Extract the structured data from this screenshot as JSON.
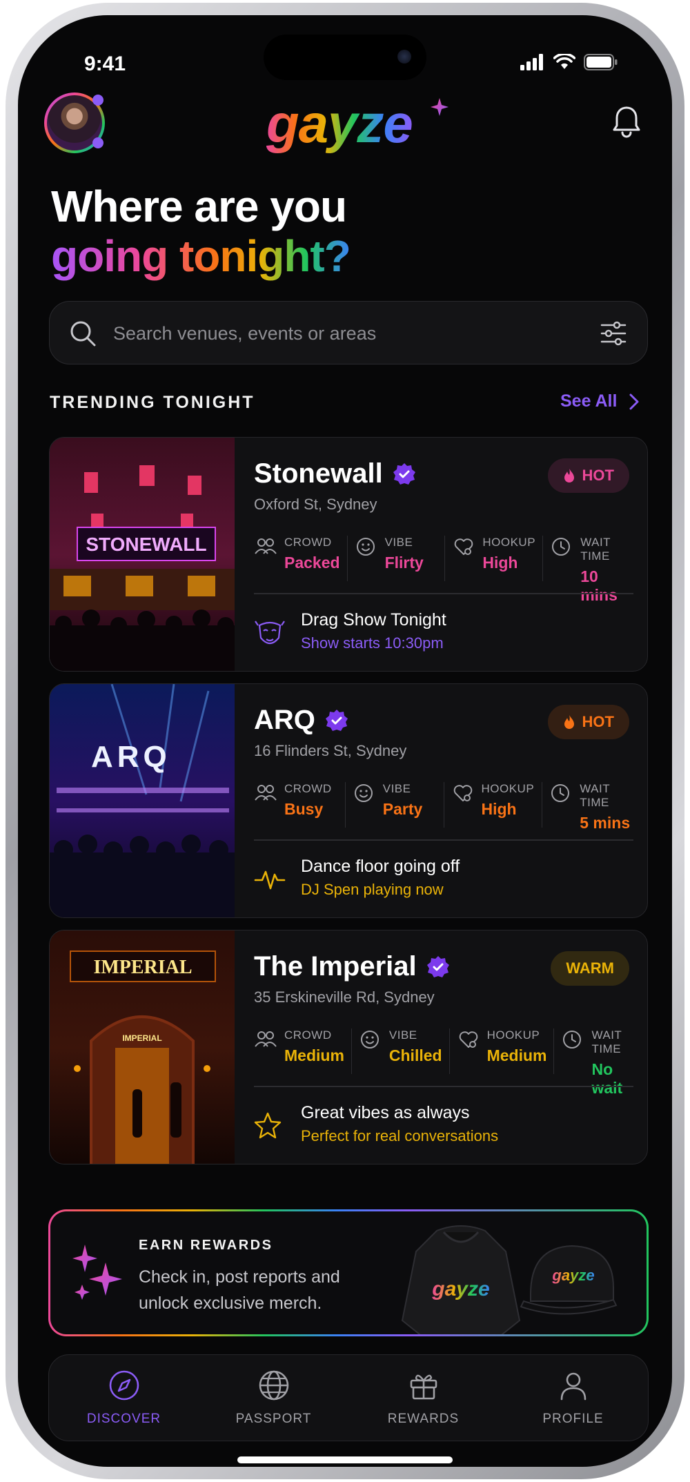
{
  "status": {
    "time": "9:41"
  },
  "header": {
    "logo": "gayze"
  },
  "hero": {
    "line1": "Where are you",
    "line2": "going tonight?"
  },
  "search": {
    "placeholder": "Search venues, events or areas"
  },
  "trending": {
    "title": "TRENDING TONIGHT",
    "see_all": "See All"
  },
  "labels": {
    "crowd": "CROWD",
    "vibe": "VIBE",
    "hookup": "HOOKUP",
    "wait": "WAIT TIME"
  },
  "venues": [
    {
      "name": "Stonewall",
      "address": "Oxford St, Sydney",
      "sign": "STONEWALL",
      "badge": "HOT",
      "badge_color": "#ec4899",
      "crowd": "Packed",
      "vibe": "Flirty",
      "hookup": "High",
      "wait": "10 mins",
      "value_color": "#ec4899",
      "note_title": "Drag Show Tonight",
      "note_sub": "Show starts 10:30pm",
      "note_color": "#8b5cf6",
      "note_icon": "drag-mask-icon"
    },
    {
      "name": "ARQ",
      "address": "16 Flinders St, Sydney",
      "sign": "ARQ",
      "badge": "HOT",
      "badge_color": "#f97316",
      "crowd": "Busy",
      "vibe": "Party",
      "hookup": "High",
      "wait": "5 mins",
      "value_color": "#f97316",
      "note_title": "Dance floor going off",
      "note_sub": "DJ Spen playing now",
      "note_color": "#eab308",
      "note_icon": "pulse-icon"
    },
    {
      "name": "The Imperial",
      "address": "35 Erskineville Rd, Sydney",
      "sign": "IMPERIAL",
      "badge": "WARM",
      "badge_color": "#eab308",
      "crowd": "Medium",
      "vibe": "Chilled",
      "hookup": "Medium",
      "wait": "No wait",
      "value_color": "#eab308",
      "wait_color": "#22c55e",
      "note_title": "Great vibes as always",
      "note_sub": "Perfect for real conversations",
      "note_color": "#eab308",
      "note_icon": "star-icon"
    }
  ],
  "rewards": {
    "title": "EARN REWARDS",
    "text": "Check in, post reports and unlock exclusive merch.",
    "merch_logo": "gayze"
  },
  "tabs": [
    {
      "label": "DISCOVER",
      "icon": "compass-icon",
      "active": true
    },
    {
      "label": "PASSPORT",
      "icon": "globe-icon",
      "active": false
    },
    {
      "label": "REWARDS",
      "icon": "gift-icon",
      "active": false
    },
    {
      "label": "PROFILE",
      "icon": "user-icon",
      "active": false
    }
  ],
  "colors": {
    "accent": "#8b5cf6",
    "background": "#070708",
    "card": "#111113"
  }
}
